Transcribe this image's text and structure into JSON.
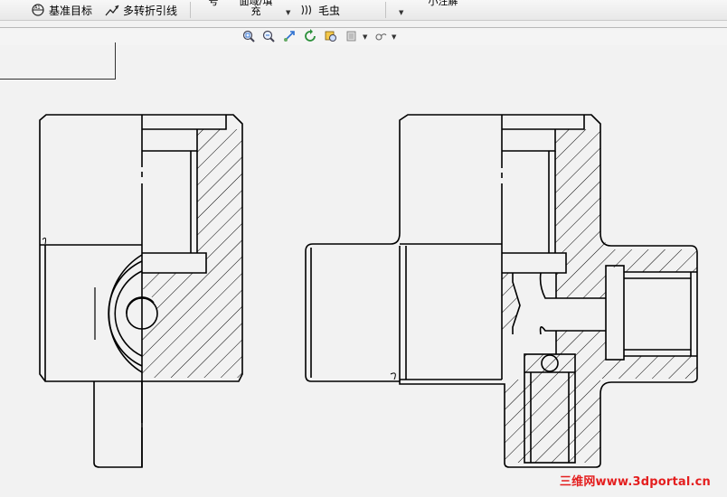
{
  "toolbar": {
    "datum_target_label": "基准目标",
    "multi_jog_leader_label": "多转折引线",
    "symbol_partial": "号",
    "hatch_fill_line1": "面域/填",
    "hatch_fill_line2": "充",
    "cosmetic_thread_label": "毛虫",
    "partial_top_right": "小注解"
  },
  "icons": {
    "datum_target": "datum-target-icon",
    "multi_jog_leader": "multi-jog-leader-icon",
    "cosmetic_thread": "cosmetic-thread-icon",
    "zoom_to_fit": "zoom-to-fit-icon",
    "zoom_to_area": "zoom-to-area-icon",
    "pan": "pan-icon",
    "rotate": "rotate-icon",
    "zoom_in_out": "zoom-in-out-icon",
    "display_style": "display-style-icon",
    "hide_show": "hide-show-icon"
  },
  "colors": {
    "watermark": "#e41e1e",
    "background": "#f2f2f2",
    "line": "#000000"
  },
  "watermark": "三维网www.3dportal.cn"
}
